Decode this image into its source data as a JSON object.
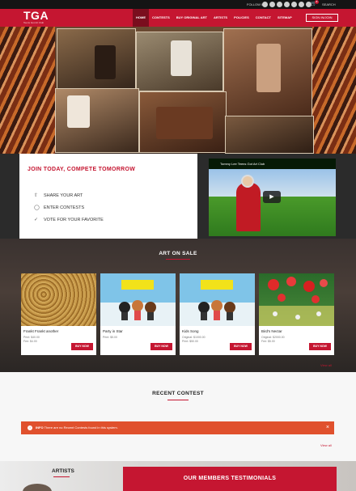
{
  "topbar": {
    "follow_label": "FOLLOW US",
    "social_icons": [
      "facebook-icon",
      "twitter-icon",
      "google-plus-icon",
      "linkedin-icon",
      "youtube-icon",
      "pinterest-icon",
      "instagram-icon"
    ],
    "cart_count": "0",
    "search_label": "SEARCH"
  },
  "navbar": {
    "logo": "TGA",
    "tagline": "Teens Got Art Club",
    "menu": [
      "HOME",
      "CONTESTS",
      "BUY ORIGINAL ART",
      "ARTISTS",
      "POLICIES",
      "CONTACT",
      "SITEMAP"
    ],
    "active_index": 0,
    "signin_label": "SIGN IN/JOIN",
    "accent_color": "#c51631"
  },
  "join": {
    "title": "JOIN TODAY, COMPETE TOMORROW",
    "steps": [
      {
        "icon": "upload-icon",
        "label": "SHARE YOUR ART"
      },
      {
        "icon": "lightbulb-icon",
        "label": "ENTER CONTESTS"
      },
      {
        "icon": "checkmark-icon",
        "label": "VOTE FOR YOUR FAVORITE"
      }
    ]
  },
  "video": {
    "title": "Tommy Lee Teens Got Art Club"
  },
  "art_on_sale": {
    "title": "ART ON SALE",
    "view_all": "View all",
    "items": [
      {
        "name": "Frankt Frankt another",
        "line1": "Print: $40.00",
        "line2": "Fee: $4.00",
        "buy": "BUY NOW"
      },
      {
        "name": "Party in Star",
        "line1": "Print: $5.00",
        "line2": "",
        "buy": "BUY NOW"
      },
      {
        "name": "Kids Song",
        "line1": "Original: $1000.00",
        "line2": "Print: $50.00",
        "buy": "BUY NOW"
      },
      {
        "name": "Bird's Nectar",
        "line1": "Original: $2000.00",
        "line2": "Fee: $5.00",
        "buy": "BUY NOW"
      }
    ]
  },
  "recent_contest": {
    "title": "RECENT CONTEST",
    "alert_tag": "INFO",
    "alert_text": "There are no Recent Contests found in this system.",
    "view_all": "View all"
  },
  "bottom": {
    "artists_title": "ARTISTS",
    "testimonials_title": "OUR MEMBERS TESTIMONIALS"
  }
}
